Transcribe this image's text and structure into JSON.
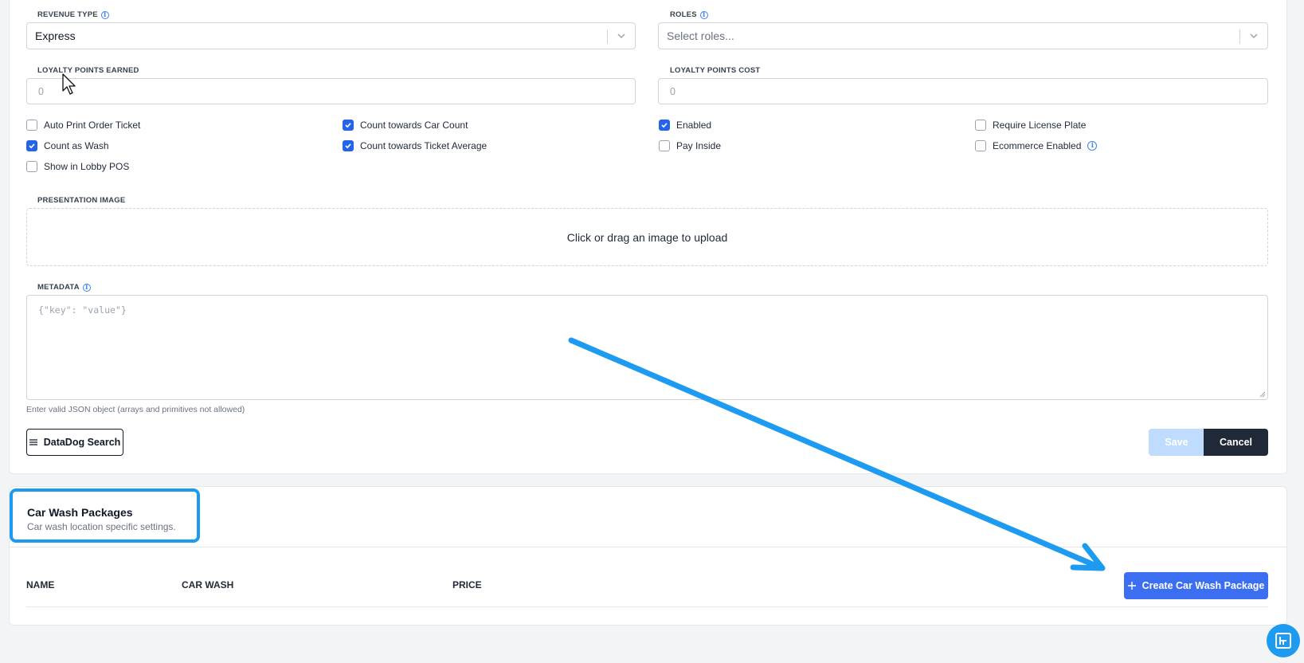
{
  "form": {
    "revenue_type": {
      "label": "REVENUE TYPE",
      "value": "Express"
    },
    "roles": {
      "label": "ROLES",
      "placeholder": "Select roles..."
    },
    "loyalty_points_earned": {
      "label": "LOYALTY POINTS EARNED",
      "placeholder": "0"
    },
    "loyalty_points_cost": {
      "label": "LOYALTY POINTS COST",
      "placeholder": "0"
    },
    "checkboxes": [
      {
        "label": "Auto Print Order Ticket",
        "checked": false
      },
      {
        "label": "Count towards Car Count",
        "checked": true
      },
      {
        "label": "Enabled",
        "checked": true
      },
      {
        "label": "Require License Plate",
        "checked": false
      },
      {
        "label": "Count as Wash",
        "checked": true
      },
      {
        "label": "Count towards Ticket Average",
        "checked": true
      },
      {
        "label": "Pay Inside",
        "checked": false
      },
      {
        "label": "Ecommerce Enabled",
        "checked": false
      },
      {
        "label": "Show in Lobby POS",
        "checked": false
      }
    ],
    "presentation_image": {
      "label": "PRESENTATION IMAGE",
      "upload_text": "Click or drag an image to upload"
    },
    "metadata": {
      "label": "METADATA",
      "placeholder": "{\"key\": \"value\"}",
      "help": "Enter valid JSON object (arrays and primitives not allowed)"
    },
    "datadog_button": "DataDog Search",
    "save_button": "Save",
    "cancel_button": "Cancel"
  },
  "packages": {
    "title": "Car Wash Packages",
    "subtitle": "Car wash location specific settings.",
    "columns": [
      "NAME",
      "CAR WASH",
      "PRICE"
    ],
    "create_button": "Create Car Wash Package"
  },
  "colors": {
    "primary": "#3b6ef0",
    "annotation": "#1d9bf0",
    "dark_button": "#1f2937",
    "disabled_save": "#bfdbfe"
  }
}
